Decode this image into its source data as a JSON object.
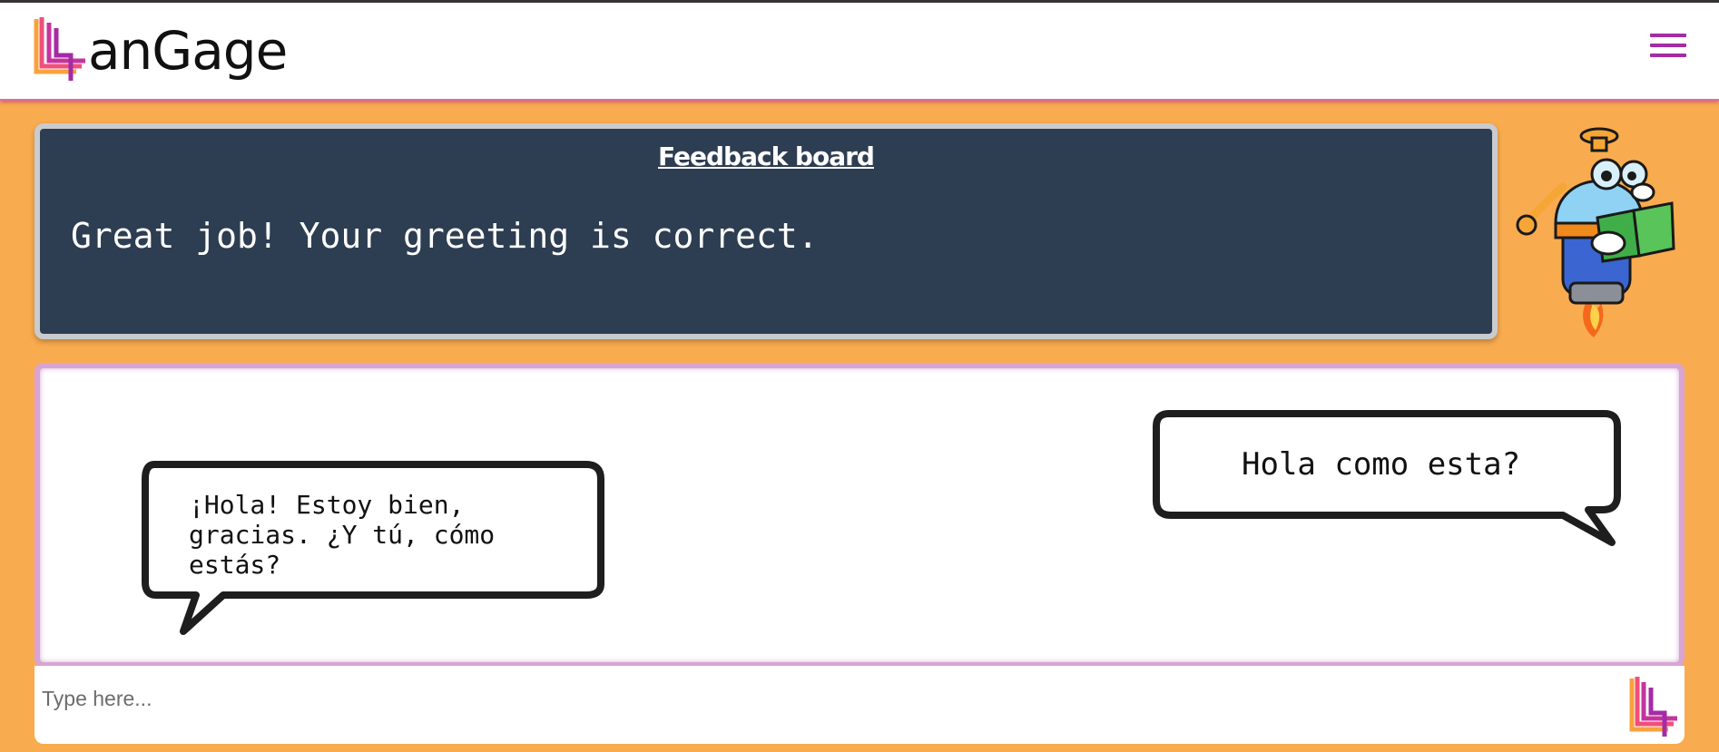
{
  "app": {
    "brand": "anGage",
    "accent_color": "#a52ba5",
    "background_color": "#f9ab4f"
  },
  "header": {
    "logo_icon": "langage-logo-icon",
    "menu_icon": "hamburger-menu-icon"
  },
  "feedback": {
    "title": "Feedback board",
    "message": "Great job! Your greeting is correct."
  },
  "mascot": {
    "icon": "robot-reading-book-icon"
  },
  "chat": {
    "messages": [
      {
        "sender": "bot",
        "lines": [
          "¡Hola! Estoy bien,",
          "gracias. ¿Y tú, cómo",
          "estás?"
        ]
      },
      {
        "sender": "user",
        "lines": [
          "Hola como esta?"
        ]
      }
    ]
  },
  "input": {
    "placeholder": "Type here...",
    "value": "",
    "send_icon": "langage-send-icon"
  }
}
